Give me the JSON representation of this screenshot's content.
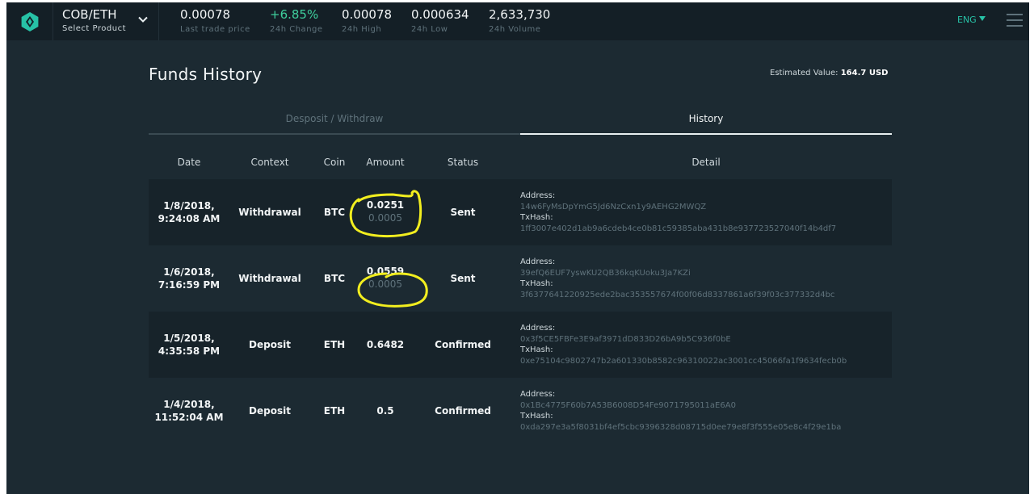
{
  "header": {
    "pair": "COB/ETH",
    "select_label": "Select Product",
    "stats": [
      {
        "value": "0.00078",
        "label": "Last trade price",
        "color": "#f2f5f6"
      },
      {
        "value": "+6.85%",
        "label": "24h Change",
        "color": "#3fcf9d"
      },
      {
        "value": "0.00078",
        "label": "24h High",
        "color": "#f2f5f6"
      },
      {
        "value": "0.000634",
        "label": "24h Low",
        "color": "#f2f5f6"
      },
      {
        "value": "2,633,730",
        "label": "24h Volume",
        "color": "#f2f5f6"
      }
    ],
    "language": "ENG",
    "icons": {
      "logo": "exchange-logo-icon",
      "dropdown": "chevron-down-icon",
      "menu": "hamburger-menu-icon"
    }
  },
  "page": {
    "title": "Funds History",
    "estimate_label": "Estimated Value:",
    "estimate_value": "164.7 USD"
  },
  "tabs": [
    {
      "label": "Desposit / Withdraw",
      "active": false
    },
    {
      "label": "History",
      "active": true
    }
  ],
  "table": {
    "columns": [
      "Date",
      "Context",
      "Coin",
      "Amount",
      "Status",
      "Detail"
    ],
    "address_label": "Address:",
    "txhash_label": "TxHash:",
    "rows": [
      {
        "date": "1/8/2018,",
        "time": "9:24:08 AM",
        "context": "Withdrawal",
        "coin": "BTC",
        "amount": "0.0251",
        "fee": "0.0005",
        "status": "Sent",
        "address": "14w6FyMsDpYmG5Jd6NzCxn1y9AEHG2MWQZ",
        "txhash": "1ff3007e402d1ab9a6cdeb4ce0b81c59385aba431b8e937723527040f14b4df7"
      },
      {
        "date": "1/6/2018,",
        "time": "7:16:59 PM",
        "context": "Withdrawal",
        "coin": "BTC",
        "amount": "0.0559",
        "fee": "0.0005",
        "status": "Sent",
        "address": "39efQ6EUF7yswKU2QB36kqKUoku3Ja7KZi",
        "txhash": "3f6377641220925ede2bac353557674f00f06d8337861a6f39f03c377332d4bc"
      },
      {
        "date": "1/5/2018,",
        "time": "4:35:58 PM",
        "context": "Deposit",
        "coin": "ETH",
        "amount": "0.6482",
        "fee": "",
        "status": "Confirmed",
        "address": "0x3f5CE5FBFe3E9af3971dD833D26bA9b5C936f0bE",
        "txhash": "0xe75104c9802747b2a601330b8582c96310022ac3001cc45066fa1f9634fecb0b"
      },
      {
        "date": "1/4/2018,",
        "time": "11:52:04 AM",
        "context": "Deposit",
        "coin": "ETH",
        "amount": "0.5",
        "fee": "",
        "status": "Confirmed",
        "address": "0x1Bc4775F60b7A53B6008D54Fe9071795011aE6A0",
        "txhash": "0xda297e3a5f8031bf4ef5cbc9396328d08715d0ee79e8f3f555e05e8c4f29e1ba"
      }
    ]
  },
  "colors": {
    "background": "#1c2a32",
    "topbar": "#141f26",
    "accent": "#27c2a6",
    "positive": "#3fcf9d",
    "annotation": "#f2ee1f"
  }
}
